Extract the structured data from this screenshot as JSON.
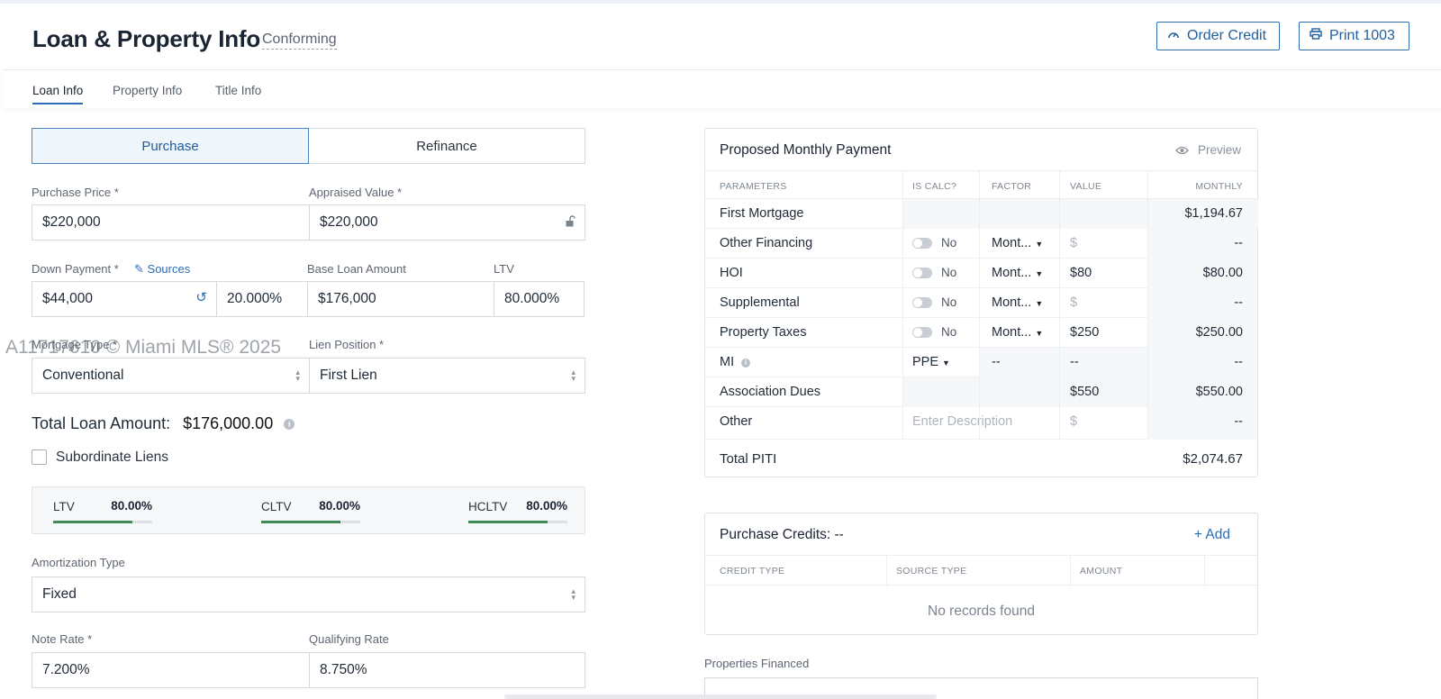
{
  "header": {
    "title": "Loan & Property Info",
    "subtitle": "Conforming",
    "order_credit": "Order Credit",
    "print": "Print 1003"
  },
  "tabs": [
    "Loan Info",
    "Property Info",
    "Title Info"
  ],
  "loan_purpose": {
    "purchase": "Purchase",
    "refinance": "Refinance"
  },
  "fields": {
    "purchase_price": {
      "label": "Purchase Price *",
      "value": "$220,000"
    },
    "appraised_value": {
      "label": "Appraised Value *",
      "value": "$220,000"
    },
    "down_payment": {
      "label": "Down Payment *",
      "sources": "Sources",
      "value": "$44,000",
      "percent": "20.000%"
    },
    "base_loan": {
      "label": "Base Loan Amount",
      "value": "$176,000"
    },
    "ltv": {
      "label": "LTV",
      "value": "80.000%"
    },
    "mortgage_type": {
      "label": "Mortgage Type *",
      "value": "Conventional"
    },
    "lien_position": {
      "label": "Lien Position *",
      "value": "First Lien"
    },
    "amortization": {
      "label": "Amortization Type",
      "value": "Fixed"
    },
    "note_rate": {
      "label": "Note Rate *",
      "value": "7.200%"
    },
    "qualifying_rate": {
      "label": "Qualifying Rate",
      "value": "8.750%"
    }
  },
  "watermark": "A11717610 © Miami MLS® 2025",
  "total_loan": {
    "label": "Total Loan Amount:",
    "value": "$176,000.00"
  },
  "subordinate": "Subordinate Liens",
  "ratios": [
    {
      "label": "LTV",
      "value": "80.00%",
      "fraction": 0.8
    },
    {
      "label": "CLTV",
      "value": "80.00%",
      "fraction": 0.8
    },
    {
      "label": "HCLTV",
      "value": "80.00%",
      "fraction": 0.8
    }
  ],
  "payment": {
    "title": "Proposed Monthly Payment",
    "preview": "Preview",
    "headers": [
      "PARAMETERS",
      "IS CALC?",
      "FACTOR",
      "VALUE",
      "MONTHLY"
    ],
    "rows": [
      {
        "name": "First Mortgage",
        "calc": "",
        "factor": "",
        "value": "",
        "monthly": "$1,194.67"
      },
      {
        "name": "Other Financing",
        "calc": "No",
        "factor": "Mont...",
        "value": "$",
        "monthly": "--"
      },
      {
        "name": "HOI",
        "calc": "No",
        "factor": "Mont...",
        "value": "$80",
        "monthly": "$80.00"
      },
      {
        "name": "Supplemental",
        "calc": "No",
        "factor": "Mont...",
        "value": "$",
        "monthly": "--"
      },
      {
        "name": "Property Taxes",
        "calc": "No",
        "factor": "Mont...",
        "value": "$250",
        "monthly": "$250.00"
      },
      {
        "name": "MI",
        "calc": "PPE",
        "factor": "--",
        "value": "--",
        "monthly": "--"
      },
      {
        "name": "Association Dues",
        "calc": "",
        "factor": "",
        "value": "$550",
        "monthly": "$550.00"
      },
      {
        "name": "Other",
        "calc": "Enter Description",
        "factor": "",
        "value": "$",
        "monthly": "--"
      }
    ],
    "total_label": "Total PITI",
    "total_value": "$2,074.67"
  },
  "credits": {
    "title": "Purchase Credits: --",
    "add": "Add",
    "headers": [
      "CREDIT TYPE",
      "SOURCE TYPE",
      "AMOUNT"
    ],
    "empty": "No records found"
  },
  "properties_financed": "Properties Financed"
}
